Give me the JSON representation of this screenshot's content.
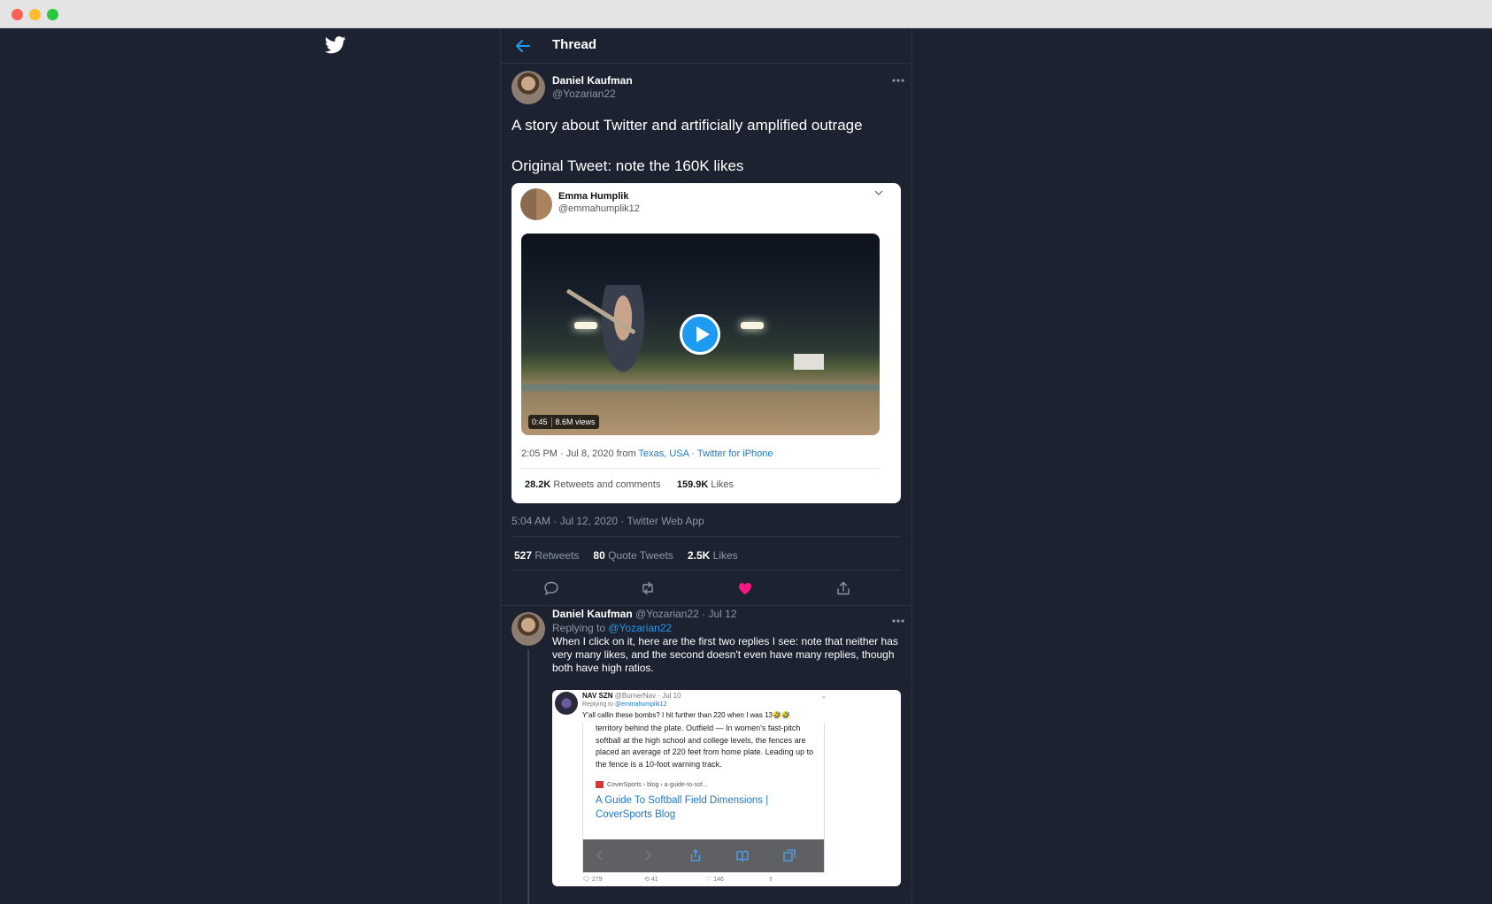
{
  "header": {
    "title": "Thread"
  },
  "main_tweet": {
    "name": "Daniel Kaufman",
    "handle": "@Yozarian22",
    "text_line1": "A story about Twitter and artificially amplified outrage",
    "text_line2": "Original Tweet: note the 160K likes",
    "timestamp": "5:04 AM · Jul 12, 2020 · Twitter Web App",
    "stats": {
      "retweets_count": "527",
      "retweets_label": "Retweets",
      "quotes_count": "80",
      "quotes_label": "Quote Tweets",
      "likes_count": "2.5K",
      "likes_label": "Likes"
    }
  },
  "embedded_tweet": {
    "name": "Emma Humplik",
    "handle": "@emmahumplik12",
    "video_duration": "0:45",
    "video_views": "8.6M views",
    "meta_time": "2:05 PM · Jul 8, 2020 from ",
    "meta_location": "Texas, USA",
    "meta_sep": " · ",
    "meta_client": "Twitter for iPhone",
    "retweets_count": "28.2K",
    "retweets_label": "Retweets and comments",
    "likes_count": "159.9K",
    "likes_label": "Likes"
  },
  "reply": {
    "name": "Daniel Kaufman",
    "handle_date": "@Yozarian22 · Jul 12",
    "replying_prefix": "Replying to ",
    "replying_to": "@Yozarian22",
    "text": "When I click on it, here are the first two replies I see: note that neither has very many likes, and the second doesn't even have many replies, though both have high ratios."
  },
  "screenshot": {
    "name": "NAV SZN",
    "handle_date": "@BurnerNav · Jul 10",
    "replying_prefix": "Replying to ",
    "replying_to": "@emmahumplik12",
    "text": "Y'all callin these bombs? I hit further than 220 when I was 13🤣🤣",
    "inner_text": "territory behind the plate. Outfield — In women's fast-pitch softball at the high school and college levels, the fences are placed an average of 220 feet from home plate. Leading up to the fence is a 10-foot warning track.",
    "source": "CoverSports › blog › a-guide-to-sof...",
    "link_title": "A Guide To Softball Field Dimensions | CoverSports Blog",
    "replies": "279",
    "retweets": "41",
    "likes": "146"
  },
  "colors": {
    "accent": "#1d9bf0",
    "like": "#f91880",
    "background": "#1c2230"
  }
}
